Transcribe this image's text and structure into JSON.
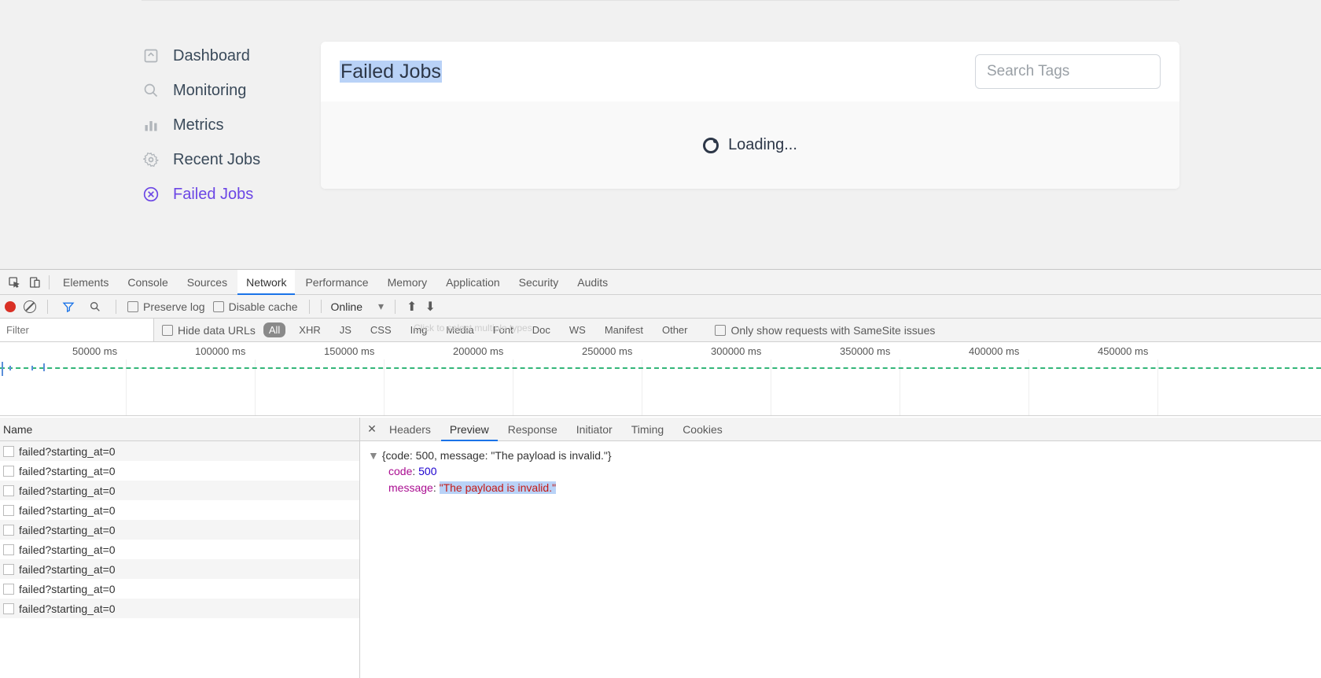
{
  "sidebar": {
    "items": [
      {
        "icon": "dashboard-icon",
        "label": "Dashboard",
        "active": false
      },
      {
        "icon": "search-icon",
        "label": "Monitoring",
        "active": false
      },
      {
        "icon": "metrics-icon",
        "label": "Metrics",
        "active": false
      },
      {
        "icon": "gear-icon",
        "label": "Recent Jobs",
        "active": false
      },
      {
        "icon": "error-circle-icon",
        "label": "Failed Jobs",
        "active": true
      }
    ]
  },
  "main": {
    "title": "Failed Jobs",
    "search_placeholder": "Search Tags",
    "loading_text": "Loading..."
  },
  "devtools": {
    "tabs": [
      "Elements",
      "Console",
      "Sources",
      "Network",
      "Performance",
      "Memory",
      "Application",
      "Security",
      "Audits"
    ],
    "active_tab": "Network",
    "toolbar": {
      "preserve_log": "Preserve log",
      "disable_cache": "Disable cache",
      "throttle": "Online"
    },
    "filter": {
      "placeholder": "Filter",
      "hide_data_urls": "Hide data URLs",
      "types": [
        "All",
        "XHR",
        "JS",
        "CSS",
        "Img",
        "Media",
        "Font",
        "Doc",
        "WS",
        "Manifest",
        "Other"
      ],
      "active_type": "All",
      "hint": "Click to select multiple types",
      "samesite": "Only show requests with SameSite issues"
    },
    "timeline": {
      "labels": [
        "50000 ms",
        "100000 ms",
        "150000 ms",
        "200000 ms",
        "250000 ms",
        "300000 ms",
        "350000 ms",
        "400000 ms",
        "450000 ms"
      ]
    },
    "requests": {
      "column_header": "Name",
      "rows": [
        "failed?starting_at=0",
        "failed?starting_at=0",
        "failed?starting_at=0",
        "failed?starting_at=0",
        "failed?starting_at=0",
        "failed?starting_at=0",
        "failed?starting_at=0",
        "failed?starting_at=0",
        "failed?starting_at=0"
      ]
    },
    "detail_tabs": [
      "Headers",
      "Preview",
      "Response",
      "Initiator",
      "Timing",
      "Cookies"
    ],
    "active_detail_tab": "Preview",
    "preview": {
      "summary": "{code: 500, message: \"The payload is invalid.\"}",
      "code_key": "code",
      "code_val": "500",
      "message_key": "message",
      "message_val": "\"The payload is invalid.\""
    }
  }
}
